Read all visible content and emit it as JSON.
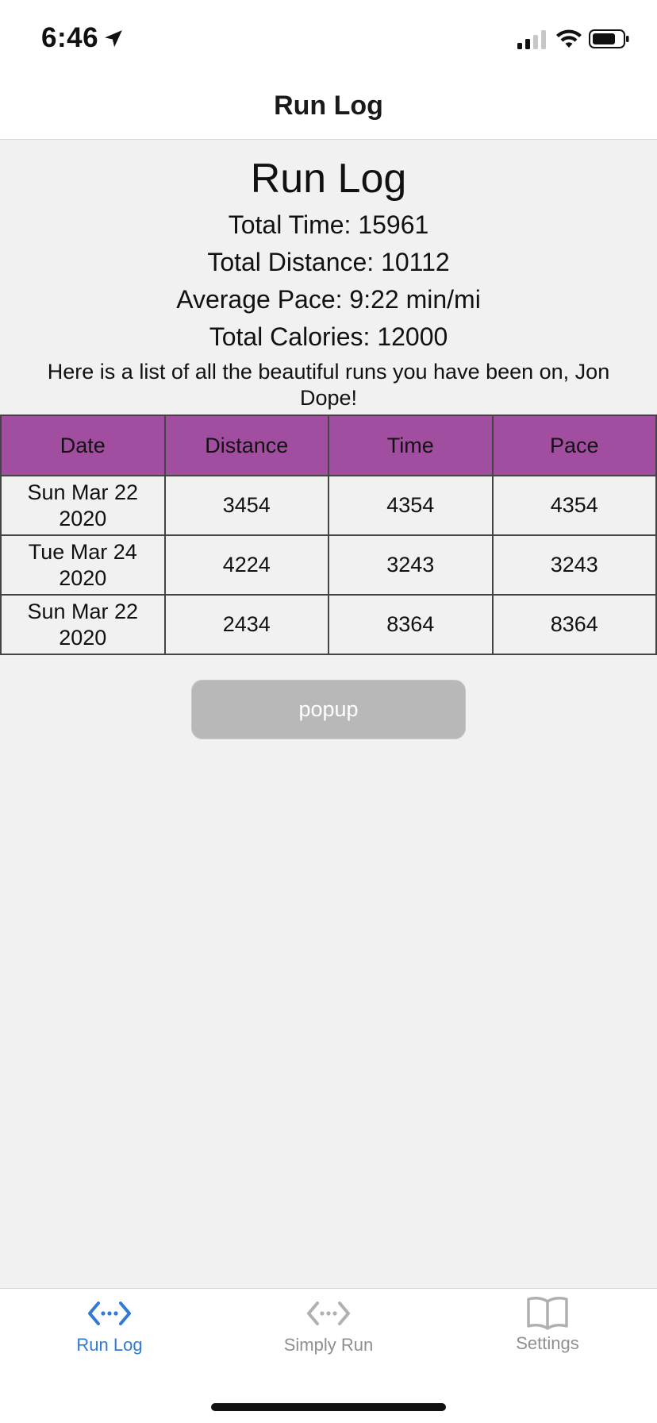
{
  "status_bar": {
    "time": "6:46"
  },
  "header": {
    "title": "Run Log"
  },
  "main": {
    "heading": "Run Log",
    "stats": {
      "total_time": "Total Time: 15961",
      "total_distance": "Total Distance: 10112",
      "average_pace": "Average Pace: 9:22 min/mi",
      "total_calories": "Total Calories: 12000"
    },
    "intro": "Here is a list of all the beautiful runs you have been on, Jon Dope!",
    "table": {
      "columns": [
        "Date",
        "Distance",
        "Time",
        "Pace"
      ],
      "rows": [
        {
          "date": "Sun Mar 22 2020",
          "distance": "3454",
          "time": "4354",
          "pace": "4354"
        },
        {
          "date": "Tue Mar 24 2020",
          "distance": "4224",
          "time": "3243",
          "pace": "3243"
        },
        {
          "date": "Sun Mar 22 2020",
          "distance": "2434",
          "time": "8364",
          "pace": "8364"
        }
      ]
    },
    "popup_button": "popup"
  },
  "tab_bar": {
    "tabs": [
      {
        "label": "Run Log",
        "icon": "run-log-icon",
        "active": true
      },
      {
        "label": "Simply Run",
        "icon": "simply-run-icon",
        "active": false
      },
      {
        "label": "Settings",
        "icon": "book-icon",
        "active": false
      }
    ]
  },
  "colors": {
    "table_header": "#a24ea0",
    "active_tab": "#2f7ad6",
    "inactive_tab": "#8e8e93",
    "button_disabled": "#b8b8b8",
    "background": "#f1f1f1"
  }
}
